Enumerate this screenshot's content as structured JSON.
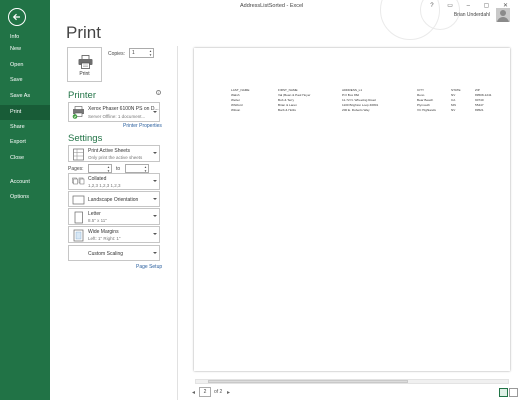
{
  "window": {
    "title": "AddressListSorted - Excel",
    "controls": "? ▭ – ▢ ✕",
    "user_name": "Brian Underdahl"
  },
  "sidebar": {
    "items": [
      {
        "label": "Info"
      },
      {
        "label": "New"
      },
      {
        "label": "Open"
      },
      {
        "label": "Save"
      },
      {
        "label": "Save As"
      },
      {
        "label": "Print",
        "active": true
      },
      {
        "label": "Share"
      },
      {
        "label": "Export"
      },
      {
        "label": "Close"
      },
      {
        "label": "Account"
      },
      {
        "label": "Options"
      }
    ]
  },
  "page": {
    "title": "Print"
  },
  "print_button": {
    "label": "Print"
  },
  "copies": {
    "label": "Copies:",
    "value": "1"
  },
  "printer": {
    "heading": "Printer",
    "name": "Xerox Phaser 6100N PS on D...",
    "status": "Server Offline: 1 document...",
    "properties_link": "Printer Properties"
  },
  "settings": {
    "heading": "Settings",
    "what": {
      "title": "Print Active Sheets",
      "sub": "Only print the active sheets"
    },
    "pages_label": "Pages:",
    "to_label": "to",
    "collate": {
      "title": "Collated",
      "sub": "1,2,3    1,2,3    1,2,3"
    },
    "orientation": {
      "title": "Landscape Orientation"
    },
    "paper": {
      "title": "Letter",
      "sub": "8.5\" x 11\""
    },
    "margins": {
      "title": "Wide Margins",
      "sub": "Left: 1\"   Right: 1\""
    },
    "scaling": {
      "title": "Custom Scaling"
    },
    "page_setup_link": "Page Setup"
  },
  "preview": {
    "current_page": "2",
    "of_label": "of 2",
    "headers": [
      "LAST_NAME",
      "FIRST_NAME",
      "ADDRESS_L1",
      "CITY",
      "STATE",
      "ZIP"
    ],
    "rows": [
      [
        "Walsh",
        "Val (Bean & Paul Hoyer",
        "P.O Box 862",
        "Reno",
        "NV",
        "89508-1241"
      ],
      [
        "Weber",
        "Bob & Terry",
        "11-72 N. Wheeling Road",
        "Bear Beach",
        "CA",
        "90740"
      ],
      [
        "Whitford",
        "Brian & Laren",
        "1100 Brighton Loop #2801",
        "Plymouth",
        "MN",
        "55447"
      ],
      [
        "Wilson",
        "Barb & Hollis",
        "200 E. Roberts Way",
        "VC Highlands",
        "NV",
        "89521"
      ]
    ]
  },
  "colors": {
    "accent": "#217346",
    "accent_dark": "#185c37",
    "link": "#2a5f9e"
  }
}
